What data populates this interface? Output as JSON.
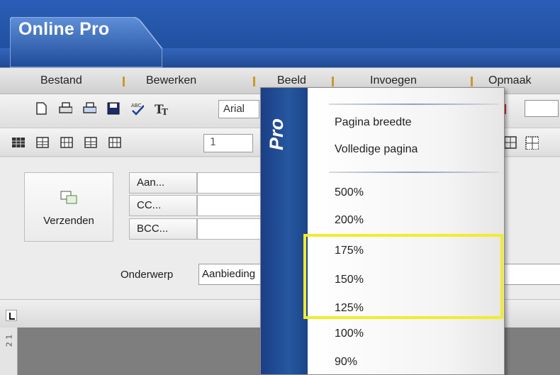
{
  "window": {
    "title": "Online Pro"
  },
  "menu": {
    "items": [
      "Bestand",
      "Bewerken",
      "Beeld",
      "Invoegen",
      "Opmaak"
    ]
  },
  "toolbar": {
    "font_value": "Arial",
    "size_value": "1"
  },
  "mail": {
    "send_label": "Verzenden",
    "to_label": "Aan...",
    "cc_label": "CC...",
    "bcc_label": "BCC...",
    "subject_label": "Onderwerp",
    "subject_value": "Aanbieding"
  },
  "ruler": {
    "vertical_mark": "2 1"
  },
  "dropdown": {
    "side_label": "Pro",
    "group1": [
      "Pagina breedte",
      "Volledige pagina"
    ],
    "zoom_levels": [
      "500%",
      "200%",
      "175%",
      "150%",
      "125%",
      "100%",
      "90%"
    ],
    "highlighted": [
      "175%",
      "150%",
      "125%"
    ]
  },
  "colors": {
    "title_blue": "#1d4b98",
    "highlight_yellow": "#f2ec2e",
    "menu_separator": "#c79a2e"
  }
}
